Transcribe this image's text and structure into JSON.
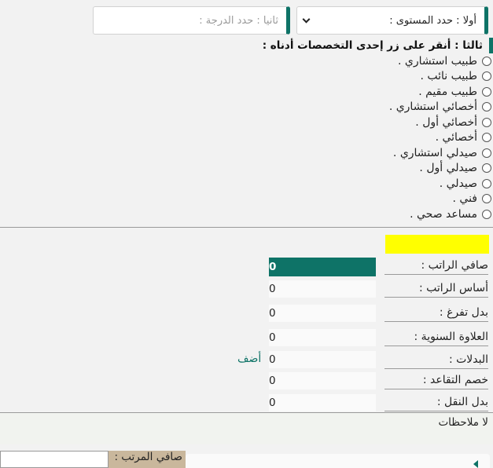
{
  "selects": {
    "level_label": "أولا : حدد المستوى :",
    "grade_placeholder": "ثانيا : حدد الدرجة :"
  },
  "step3": {
    "label": "ثالثا : أنقر على زر إحدى التخصصات أدناه :"
  },
  "specialties": [
    "طبيب استشاري .",
    "طبيب نائب .",
    "طبيب مقيم .",
    "أخصائي استشاري .",
    "أخصائي أول .",
    "أخصائي .",
    "صيدلي استشاري .",
    "صيدلي أول .",
    "صيدلي .",
    "فني .",
    "مساعد صحي ."
  ],
  "salary": {
    "net_label": "صافي الراتب :",
    "net_value": "0",
    "base_label": "أساس الراتب :",
    "base_value": "0",
    "dedication_label": "بدل تفرغ :",
    "dedication_value": "0",
    "annual_label": "العلاوة السنوية :",
    "annual_value": "0",
    "allowances_label": "البدلات :",
    "allowances_value": "0",
    "retirement_label": "خصم التقاعد :",
    "retirement_value": "0",
    "transport_label": "بدل النقل :",
    "transport_value": "0",
    "add_link": "أضف"
  },
  "notes": "لا ملاحظات",
  "bottom": {
    "label": "صافي المرتب :"
  },
  "colors": {
    "accent": "#0e7367",
    "highlight": "#ffff00"
  }
}
